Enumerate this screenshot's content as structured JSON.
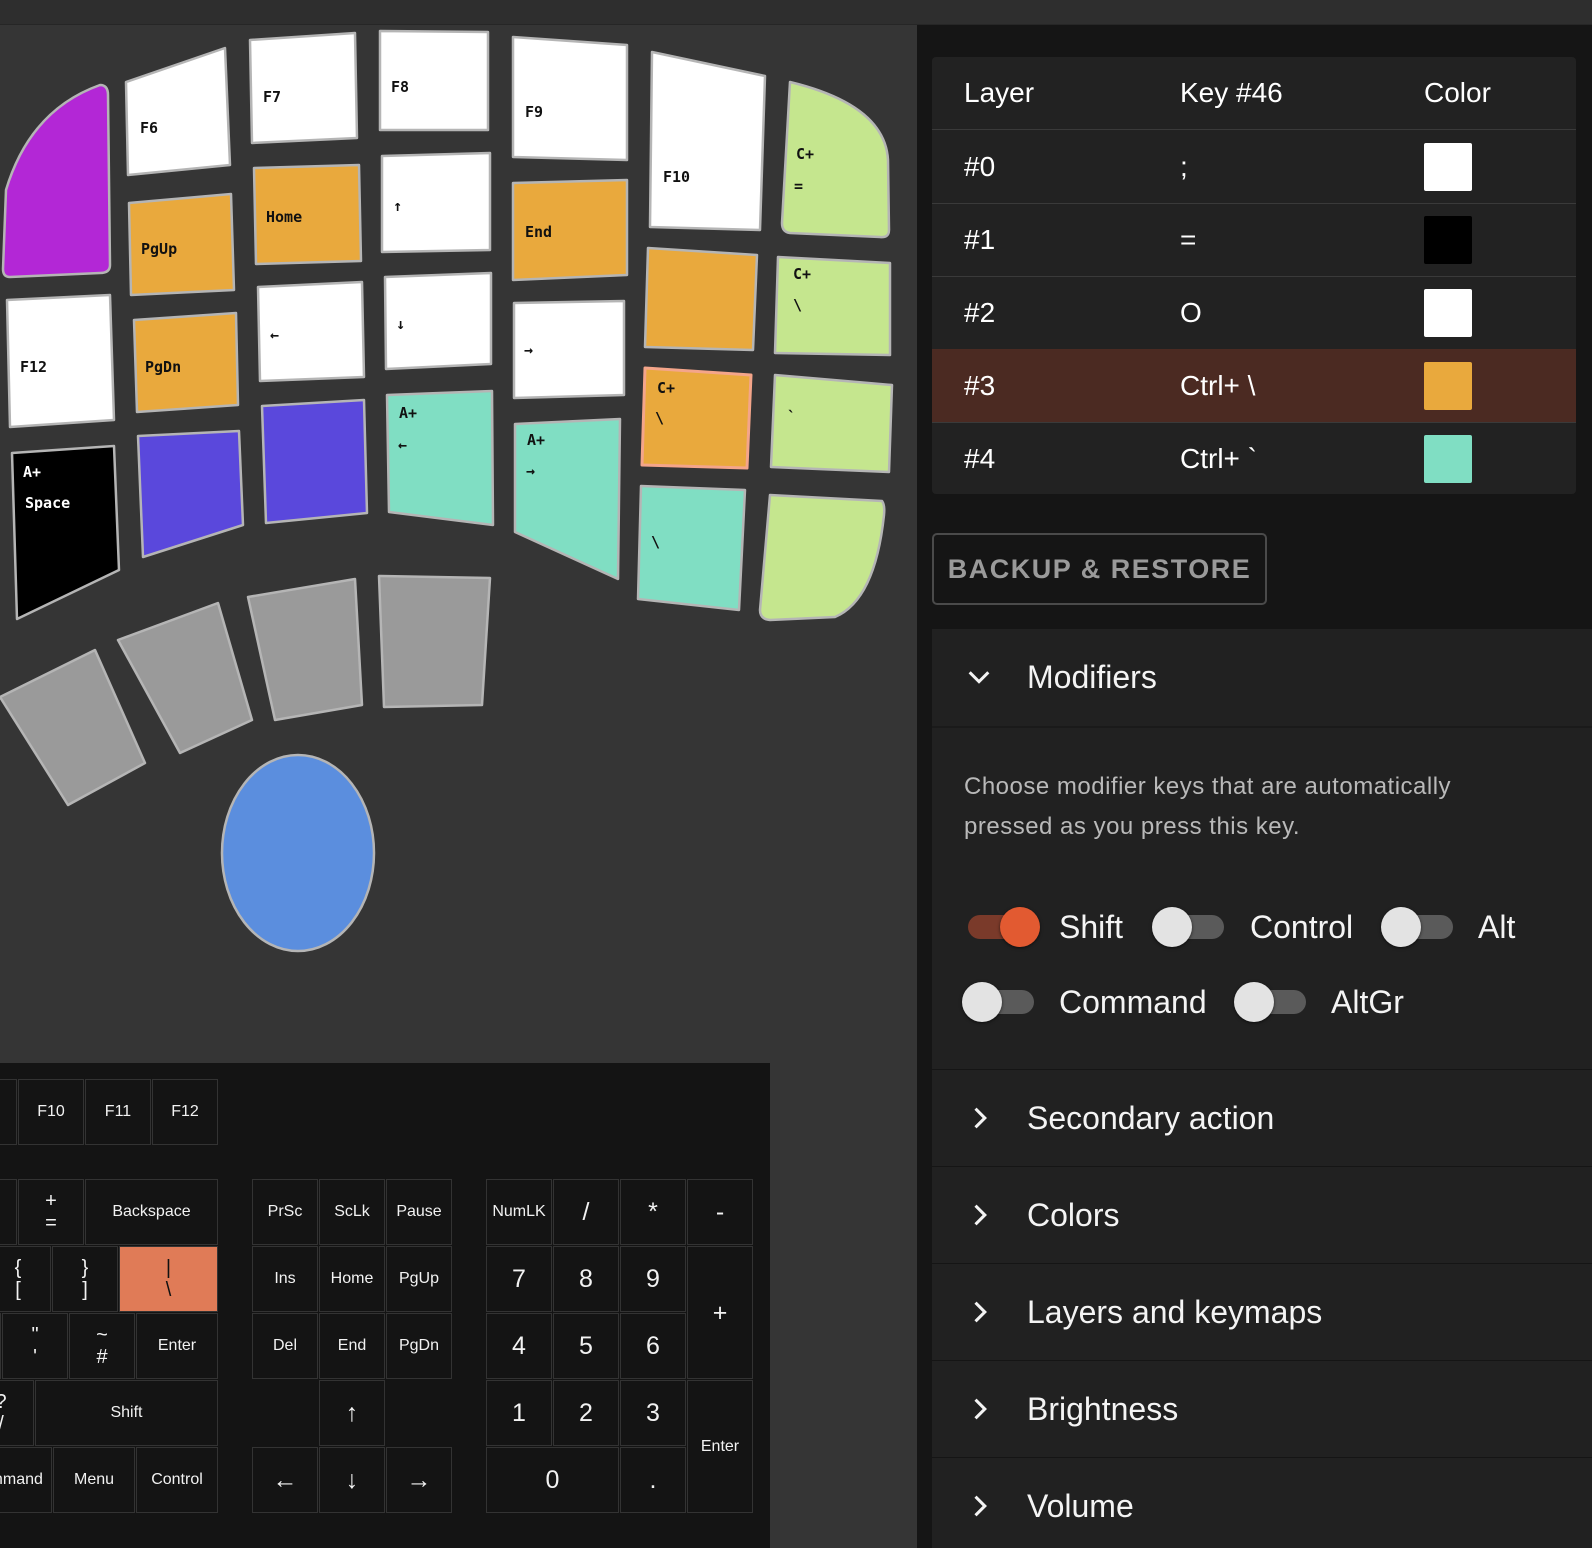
{
  "layout_keys": [
    {
      "name": "key-purple",
      "color": "#b327d6",
      "label": ""
    },
    {
      "name": "key-f6",
      "color": "#ffffff",
      "label": "F6"
    },
    {
      "name": "key-f7",
      "color": "#ffffff",
      "label": "F7"
    },
    {
      "name": "key-f8",
      "color": "#ffffff",
      "label": "F8"
    },
    {
      "name": "key-f9",
      "color": "#ffffff",
      "label": "F9"
    },
    {
      "name": "key-f10",
      "color": "#ffffff",
      "label": "F10"
    },
    {
      "name": "key-ctrl-equals",
      "color": "#c5e68e",
      "label": "C+",
      "label2": "="
    },
    {
      "name": "key-pgup",
      "color": "#e9a93d",
      "label": "PgUp"
    },
    {
      "name": "key-home",
      "color": "#e9a93d",
      "label": "Home"
    },
    {
      "name": "key-up",
      "color": "#ffffff",
      "label": "↑"
    },
    {
      "name": "key-end",
      "color": "#e9a93d",
      "label": "End"
    },
    {
      "name": "key-orange-blank",
      "color": "#e9a93d",
      "label": ""
    },
    {
      "name": "key-ctrl-backslash",
      "color": "#c5e68e",
      "label": "C+",
      "label2": "\\"
    },
    {
      "name": "key-f12",
      "color": "#ffffff",
      "label": "F12"
    },
    {
      "name": "key-pgdn",
      "color": "#e9a93d",
      "label": "PgDn"
    },
    {
      "name": "key-left",
      "color": "#ffffff",
      "label": "←"
    },
    {
      "name": "key-down",
      "color": "#ffffff",
      "label": "↓"
    },
    {
      "name": "key-right",
      "color": "#ffffff",
      "label": "→"
    },
    {
      "name": "key-selected-ctrl-backslash",
      "color": "#e9a93d",
      "label": "C+",
      "label2": "\\"
    },
    {
      "name": "key-backtick",
      "color": "#c5e68e",
      "label": "`"
    },
    {
      "name": "key-alt-space",
      "color": "#000000",
      "label": "A+",
      "label2": "Space"
    },
    {
      "name": "key-indigo-1",
      "color": "#5a48dc",
      "label": ""
    },
    {
      "name": "key-indigo-2",
      "color": "#5a48dc",
      "label": ""
    },
    {
      "name": "key-alt-left",
      "color": "#80dec3",
      "label": "A+",
      "label2": "←"
    },
    {
      "name": "key-alt-right",
      "color": "#80dec3",
      "label": "A+",
      "label2": "→"
    },
    {
      "name": "key-backslash",
      "color": "#80dec3",
      "label": "\\"
    },
    {
      "name": "key-lime-bottom",
      "color": "#c5e68e",
      "label": ""
    },
    {
      "name": "thumb-key-1",
      "color": "#9a9a9a",
      "label": ""
    },
    {
      "name": "thumb-key-2",
      "color": "#9a9a9a",
      "label": ""
    },
    {
      "name": "thumb-key-3",
      "color": "#9a9a9a",
      "label": ""
    },
    {
      "name": "thumb-key-4",
      "color": "#9a9a9a",
      "label": ""
    },
    {
      "name": "trackball",
      "color": "#5b8ede",
      "label": ""
    }
  ],
  "virtual_keyboard": {
    "fn_keys": [
      "F10",
      "F11",
      "F12"
    ],
    "row_num": {
      "plus_equals": "+\n=",
      "backspace": "Backspace"
    },
    "row_top": {
      "brace_open": "{\n[",
      "brace_close": "}\n]",
      "pipe_backslash": "|\n\\"
    },
    "row_home": {
      "quote": "\"\n'",
      "tilde_hash": "~\n#",
      "enter": "Enter"
    },
    "row_shift": {
      "question": "?\n/",
      "shift": "Shift"
    },
    "row_bottom": {
      "command": "Command",
      "menu": "Menu",
      "control": "Control"
    },
    "nav": {
      "prsc": "PrSc",
      "sclk": "ScLk",
      "pause": "Pause",
      "ins": "Ins",
      "home": "Home",
      "pgup": "PgUp",
      "del": "Del",
      "end": "End",
      "pgdn": "PgDn",
      "up": "↑",
      "left": "←",
      "down": "↓",
      "right": "→"
    },
    "numpad": {
      "numlk": "NumLK",
      "div": "/",
      "mul": "*",
      "minus": "-",
      "n7": "7",
      "n8": "8",
      "n9": "9",
      "plus": "+",
      "n4": "4",
      "n5": "5",
      "n6": "6",
      "n1": "1",
      "n2": "2",
      "n3": "3",
      "enter": "Enter",
      "n0": "0",
      "dot": "."
    }
  },
  "layer_table": {
    "headers": {
      "layer": "Layer",
      "key": "Key #46",
      "color": "Color"
    },
    "rows": [
      {
        "layer": "#0",
        "key": ";",
        "color": "#ffffff",
        "selected": false
      },
      {
        "layer": "#1",
        "key": "=",
        "color": "#000000",
        "selected": false
      },
      {
        "layer": "#2",
        "key": "O",
        "color": "#ffffff",
        "selected": false
      },
      {
        "layer": "#3",
        "key": "Ctrl+ \\",
        "color": "#e9a93d",
        "selected": true
      },
      {
        "layer": "#4",
        "key": "Ctrl+ `",
        "color": "#80dec3",
        "selected": false
      }
    ]
  },
  "backup_button": "BACKUP & RESTORE",
  "modifiers": {
    "title": "Modifiers",
    "description": "Choose modifier keys that are automatically pressed as you press this key.",
    "toggles": [
      {
        "label": "Shift",
        "on": true
      },
      {
        "label": "Control",
        "on": false
      },
      {
        "label": "Alt",
        "on": false
      },
      {
        "label": "Command",
        "on": false
      },
      {
        "label": "AltGr",
        "on": false
      }
    ]
  },
  "sections": [
    "Secondary action",
    "Colors",
    "Layers and keymaps",
    "Brightness",
    "Volume"
  ],
  "colors": {
    "accent": "#e25a31",
    "selected_row": "#4b2a22",
    "highlight_key": "#e07b57"
  }
}
